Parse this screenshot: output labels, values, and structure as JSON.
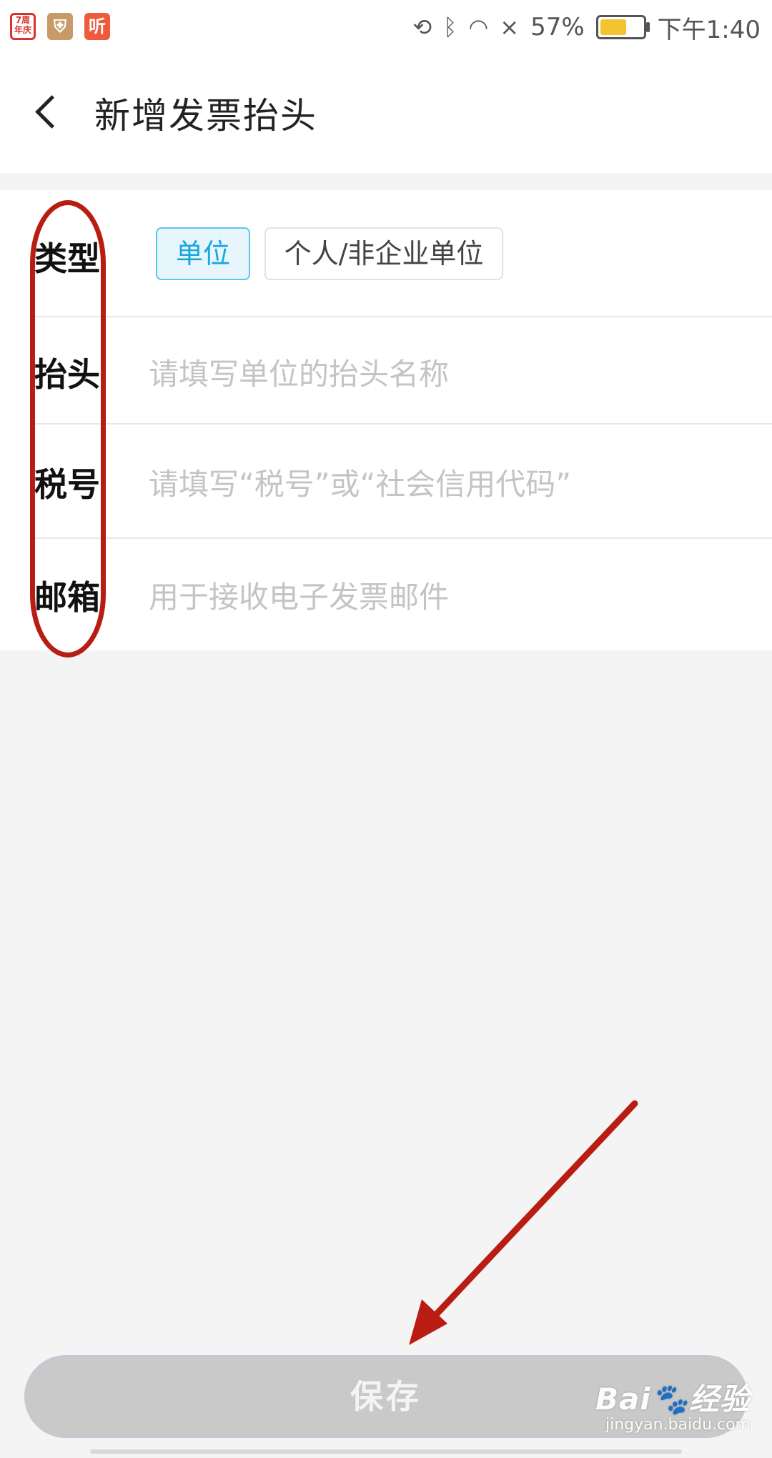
{
  "status_bar": {
    "battery_percent_text": "57%",
    "battery_level": 0.57,
    "time": "下午1:40",
    "apps": [
      "7周年庆",
      "shield-app-icon",
      "听"
    ],
    "icons": [
      "rotate-lock-icon",
      "bluetooth-icon",
      "wifi-icon",
      "cellular-no-signal-icon",
      "battery-icon"
    ]
  },
  "header": {
    "title": "新增发票抬头"
  },
  "form": {
    "type": {
      "label": "类型",
      "options": [
        "单位",
        "个人/非企业单位"
      ],
      "selected": "单位"
    },
    "title": {
      "label": "抬头",
      "placeholder": "请填写单位的抬头名称"
    },
    "tax_id": {
      "label": "税号",
      "placeholder": "请填写“税号”或“社会信用代码”"
    },
    "email": {
      "label": "邮箱",
      "placeholder": "用于接收电子发票邮件"
    }
  },
  "save_button": {
    "label": "保存"
  },
  "watermark": {
    "logo": "Bai🐾经验",
    "url": "jingyan.baidu.com"
  },
  "colors": {
    "accent": "#19a6dc",
    "annotation_red": "#b81c12",
    "button_disabled": "#c9c9c9"
  }
}
